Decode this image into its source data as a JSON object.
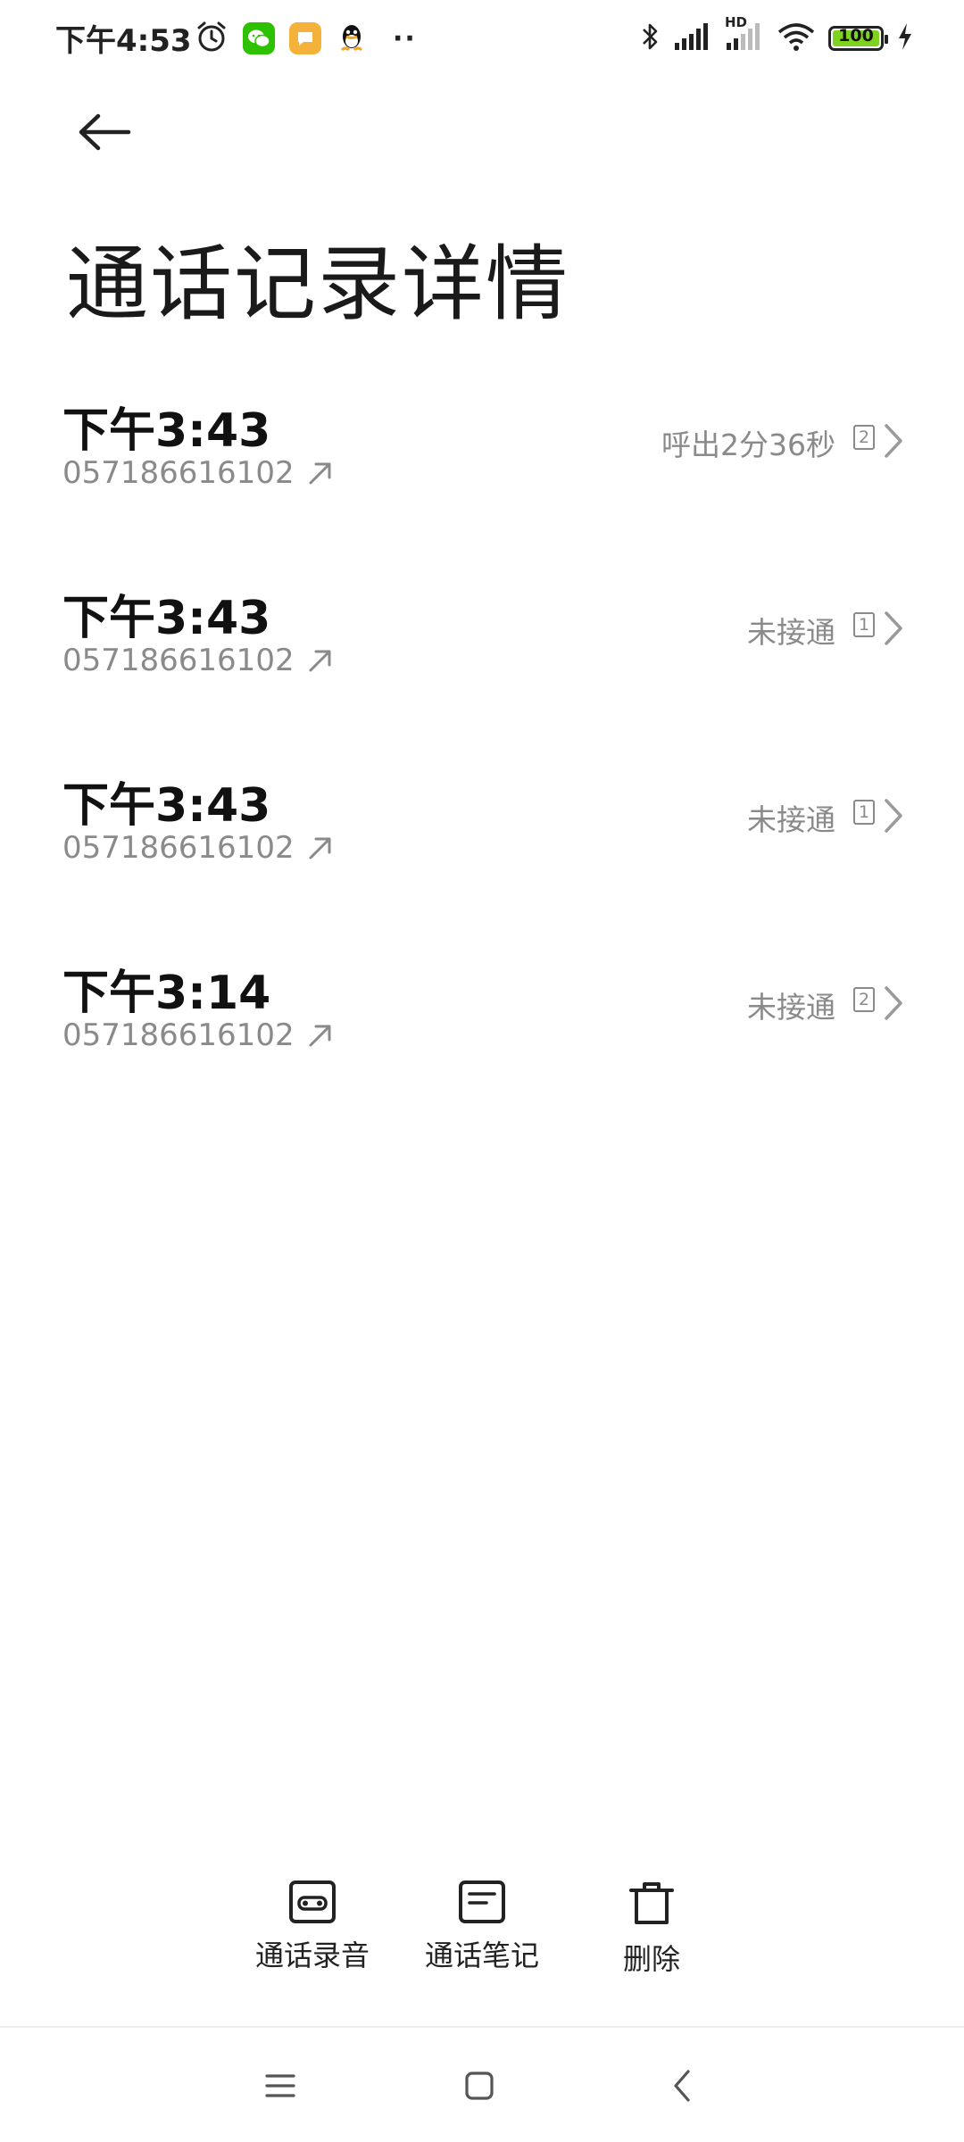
{
  "status_bar": {
    "time": "下午4:53",
    "battery": "100",
    "network_label": "HD",
    "icons_left": [
      "alarm-icon",
      "wechat-icon",
      "messages-icon",
      "qq-icon",
      "more-dots-icon"
    ],
    "icons_right": [
      "bluetooth-icon",
      "signal-icon",
      "signal-hd-icon",
      "wifi-icon",
      "battery-icon",
      "charging-icon"
    ],
    "more": "··"
  },
  "header": {
    "back_icon": "arrow-left-icon",
    "title": "通话记录详情"
  },
  "calls": [
    {
      "time": "下午3:43",
      "number": "057186616102",
      "direction_icon": "outgoing-arrow-icon",
      "status": "呼出2分36秒",
      "sim": "2"
    },
    {
      "time": "下午3:43",
      "number": "057186616102",
      "direction_icon": "outgoing-arrow-icon",
      "status": "未接通",
      "sim": "1"
    },
    {
      "time": "下午3:43",
      "number": "057186616102",
      "direction_icon": "outgoing-arrow-icon",
      "status": "未接通",
      "sim": "1"
    },
    {
      "time": "下午3:14",
      "number": "057186616102",
      "direction_icon": "outgoing-arrow-icon",
      "status": "未接通",
      "sim": "2"
    }
  ],
  "toolbar": {
    "recording_label": "通话录音",
    "notes_label": "通话笔记",
    "delete_label": "删除"
  },
  "colors": {
    "accent_battery": "#7ed321",
    "secondary_text": "#8a8a8a",
    "wechat": "#2dc100",
    "messages": "#f4b23a"
  }
}
